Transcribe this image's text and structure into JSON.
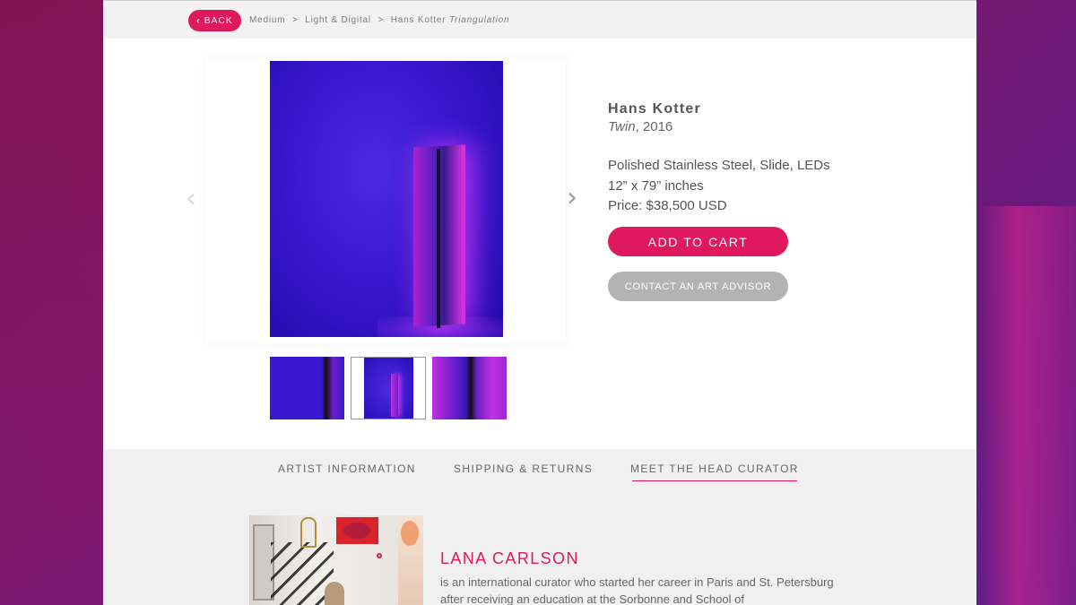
{
  "colors": {
    "accent": "#e0195e",
    "secondary_button": "#b3b3b3",
    "background": "#8a1660"
  },
  "nav": {
    "back_label": "BACK",
    "back_icon": "chevron-left-icon",
    "breadcrumb": {
      "medium": "Medium",
      "separator": ">",
      "category": "Light & Digital",
      "artist": "Hans Kotter",
      "series": "Triangulation"
    }
  },
  "gallery": {
    "prev_icon": "chevron-left-icon",
    "next_icon": "chevron-right-icon",
    "prev_glyph": "‹",
    "next_glyph": "›",
    "selected_thumbnail": 2
  },
  "artwork": {
    "artist": "Hans Kotter",
    "title": "Twin",
    "year_suffix": ", 2016",
    "materials": "Polished Stainless Steel, Slide, LEDs",
    "dimensions": "12” x 79” inches",
    "price": "Price: $38,500 USD"
  },
  "actions": {
    "add_to_cart": "ADD TO CART",
    "contact_advisor": "CONTACT AN ART ADVISOR"
  },
  "tabs": [
    {
      "label": "ARTIST INFORMATION",
      "active": false
    },
    {
      "label": "SHIPPING & RETURNS",
      "active": false
    },
    {
      "label": "MEET THE HEAD CURATOR",
      "active": true
    }
  ],
  "curator": {
    "name": "LANA CARLSON",
    "bio": "is an international curator who started her career in Paris and St. Petersburg after receiving an education at the Sorbonne and School of"
  }
}
